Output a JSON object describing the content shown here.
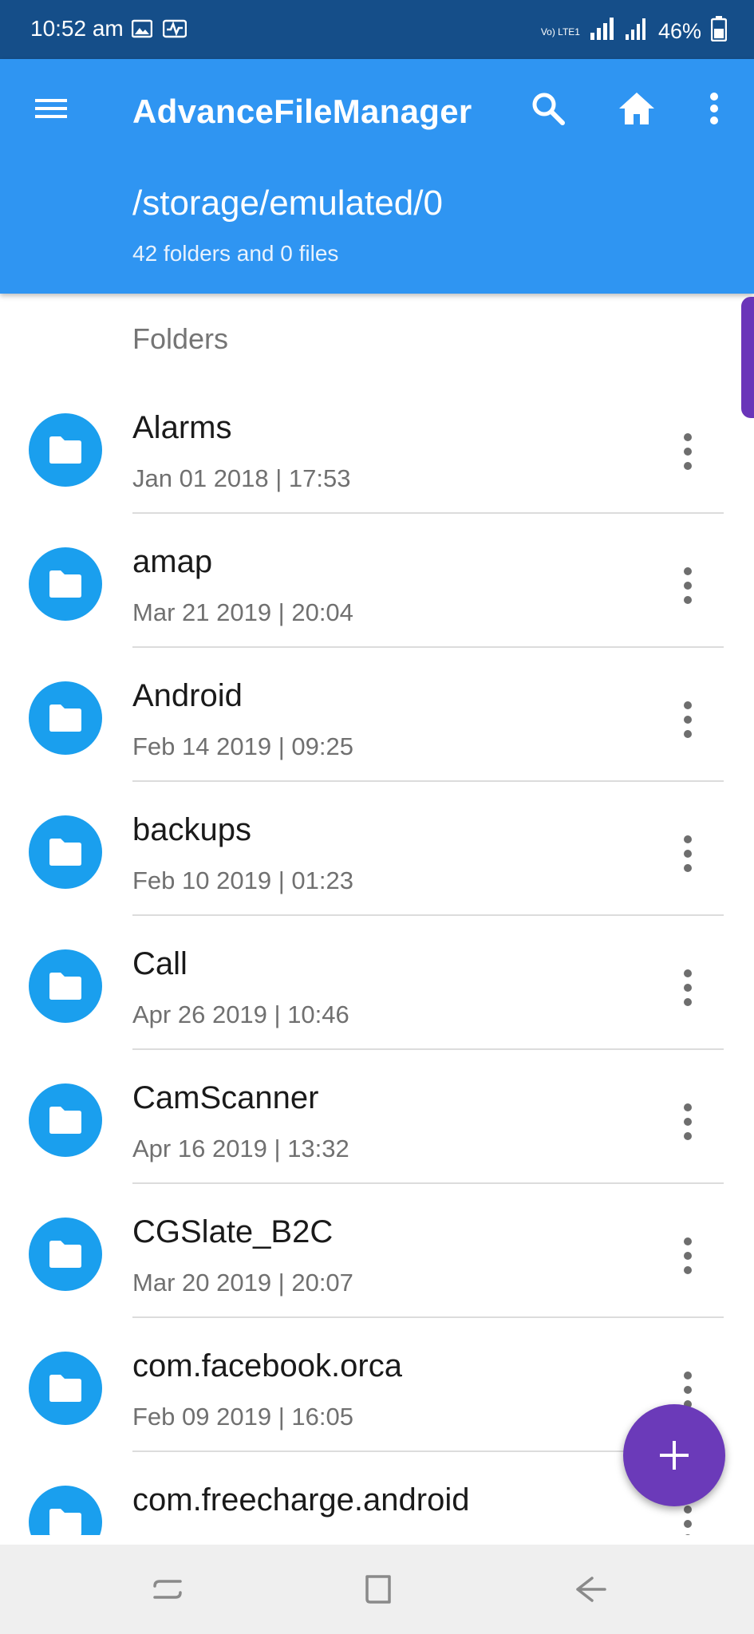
{
  "status_bar": {
    "time": "10:52 am",
    "network_label": "Vo) LTE1",
    "battery": "46%",
    "icons": [
      "gallery-icon",
      "activity-icon",
      "volte-icon",
      "signal-icon",
      "signal-icon",
      "battery-icon"
    ]
  },
  "app_bar": {
    "title": "AdvanceFileManager",
    "path": "/storage/emulated/0",
    "summary": "42 folders and 0 files",
    "icons": [
      "menu-icon",
      "search-icon",
      "home-icon",
      "more-vert-icon"
    ],
    "color": "#2f95f2"
  },
  "list": {
    "section_label": "Folders",
    "items": [
      {
        "name": "Alarms",
        "date": "Jan 01 2018 | 17:53"
      },
      {
        "name": "amap",
        "date": "Mar 21 2019 | 20:04"
      },
      {
        "name": "Android",
        "date": "Feb 14 2019 | 09:25"
      },
      {
        "name": "backups",
        "date": "Feb 10 2019 | 01:23"
      },
      {
        "name": "Call",
        "date": "Apr 26 2019 | 10:46"
      },
      {
        "name": "CamScanner",
        "date": "Apr 16 2019 | 13:32"
      },
      {
        "name": "CGSlate_B2C",
        "date": "Mar 20 2019 | 20:07"
      },
      {
        "name": "com.facebook.orca",
        "date": "Feb 09 2019 | 16:05"
      },
      {
        "name": "com.freecharge.android",
        "date": ""
      }
    ],
    "folder_icon_color": "#1a9fee"
  },
  "fab": {
    "icon": "add-icon",
    "color": "#6b3ab9"
  },
  "nav_bar": {
    "icons": [
      "recent-apps-icon",
      "home-nav-icon",
      "back-icon"
    ]
  }
}
